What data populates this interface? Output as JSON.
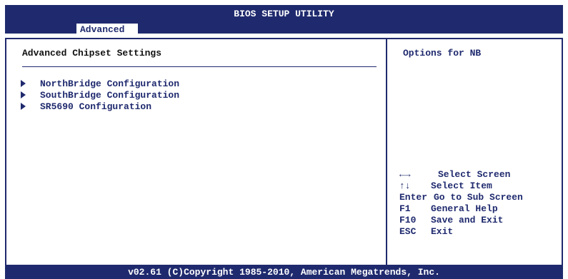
{
  "header": {
    "title": "BIOS SETUP UTILITY",
    "active_tab": "Advanced"
  },
  "main": {
    "section_title": "Advanced Chipset Settings",
    "menu_items": [
      {
        "label": "NorthBridge Configuration"
      },
      {
        "label": "SouthBridge Configuration"
      },
      {
        "label": "SR5690 Configuration"
      }
    ]
  },
  "help": {
    "description": "Options for NB",
    "keys": [
      {
        "key": "←→",
        "action": "Select Screen"
      },
      {
        "key": "↑↓",
        "action": "Select Item"
      },
      {
        "key": "Enter",
        "action": "Go to Sub Screen"
      },
      {
        "key": "F1",
        "action": "General Help"
      },
      {
        "key": "F10",
        "action": "Save and Exit"
      },
      {
        "key": "ESC",
        "action": "Exit"
      }
    ]
  },
  "footer": {
    "copyright": "v02.61 (C)Copyright 1985-2010, American Megatrends, Inc."
  },
  "colors": {
    "primary": "#1f2a6e",
    "background": "#ffffff"
  }
}
